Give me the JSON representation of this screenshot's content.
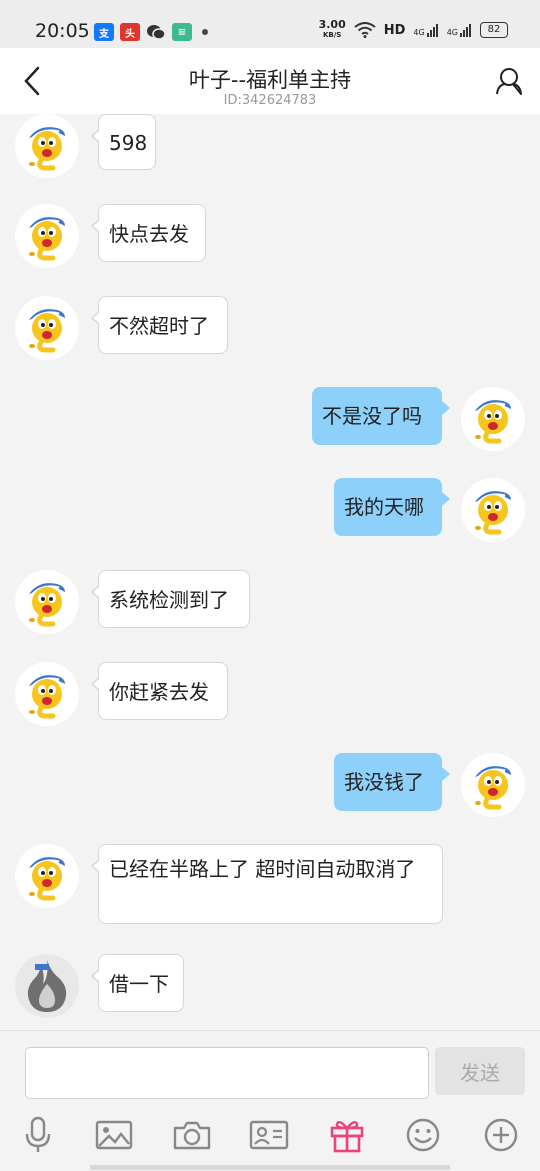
{
  "status_bar": {
    "time": "20:05",
    "speed_value": "3.00",
    "speed_unit": "KB/S",
    "hd_label": "HD",
    "signal_1": "4G",
    "signal_2": "4G",
    "battery": "82"
  },
  "header": {
    "title": "叶子--福利单主持",
    "subtitle": "ID:342624783"
  },
  "messages": [
    {
      "side": "in",
      "text": "598",
      "avatar": "emoji-avatar"
    },
    {
      "side": "in",
      "text": "快点去发",
      "avatar": "emoji-avatar"
    },
    {
      "side": "in",
      "text": "不然超时了",
      "avatar": "emoji-avatar"
    },
    {
      "side": "out",
      "text": "不是没了吗",
      "avatar": "emoji-avatar"
    },
    {
      "side": "out",
      "text": "我的天哪",
      "avatar": "emoji-avatar"
    },
    {
      "side": "in",
      "text": "系统检测到了",
      "avatar": "emoji-avatar"
    },
    {
      "side": "in",
      "text": "你赶紧去发",
      "avatar": "emoji-avatar"
    },
    {
      "side": "out",
      "text": "我没钱了",
      "avatar": "emoji-avatar"
    },
    {
      "side": "in",
      "text": "已经在半路上了 超时间自动取消了",
      "avatar": "emoji-avatar"
    },
    {
      "side": "in",
      "text": "借一下",
      "avatar": "flame-avatar"
    }
  ],
  "input": {
    "placeholder": "",
    "send_label": "发送"
  },
  "toolbar": [
    "microphone-icon",
    "image-icon",
    "camera-icon",
    "contact-card-icon",
    "gift-icon",
    "emoji-icon",
    "plus-icon"
  ],
  "colors": {
    "outgoing_bubble": "#8dd0f9",
    "incoming_bubble": "#ffffff",
    "gift_accent": "#e8457a"
  }
}
